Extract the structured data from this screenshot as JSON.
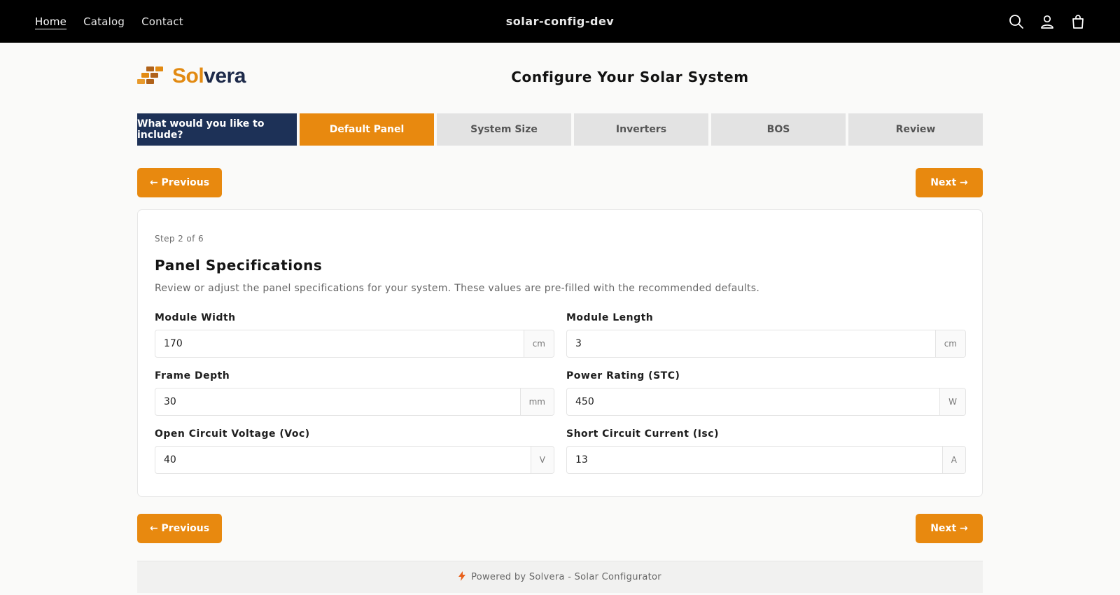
{
  "topbar": {
    "nav": [
      {
        "label": "Home",
        "active": true
      },
      {
        "label": "Catalog",
        "active": false
      },
      {
        "label": "Contact",
        "active": false
      }
    ],
    "store_name": "solar-config-dev",
    "icons": [
      "search-icon",
      "account-icon",
      "cart-icon"
    ]
  },
  "header": {
    "logo_part1": "Sol",
    "logo_part2": "vera",
    "title": "Configure Your Solar System"
  },
  "steps": [
    {
      "label": "What would you like to include?",
      "state": "completed"
    },
    {
      "label": "Default Panel",
      "state": "active"
    },
    {
      "label": "System Size",
      "state": "pending"
    },
    {
      "label": "Inverters",
      "state": "pending"
    },
    {
      "label": "BOS",
      "state": "pending"
    },
    {
      "label": "Review",
      "state": "pending"
    }
  ],
  "buttons": {
    "previous": "← Previous",
    "next": "Next →"
  },
  "card": {
    "step_count": "Step 2 of 6",
    "title": "Panel Specifications",
    "description": "Review or adjust the panel specifications for your system. These values are pre-filled with the recommended defaults.",
    "fields": {
      "module_width": {
        "label": "Module Width",
        "value": "170",
        "unit": "cm"
      },
      "module_length": {
        "label": "Module Length",
        "value": "3",
        "unit": "cm"
      },
      "frame_depth": {
        "label": "Frame Depth",
        "value": "30",
        "unit": "mm"
      },
      "power_rating": {
        "label": "Power Rating (STC)",
        "value": "450",
        "unit": "W"
      },
      "voc": {
        "label": "Open Circuit Voltage (Voc)",
        "value": "40",
        "unit": "V"
      },
      "isc": {
        "label": "Short Circuit Current (Isc)",
        "value": "13",
        "unit": "A"
      }
    }
  },
  "footer": {
    "text": "Powered by Solvera - Solar Configurator",
    "icon": "lightning-icon"
  },
  "colors": {
    "accent": "#e8890f",
    "navy": "#1d3157",
    "pending": "#e3e3e3",
    "topbar": "#000000"
  }
}
